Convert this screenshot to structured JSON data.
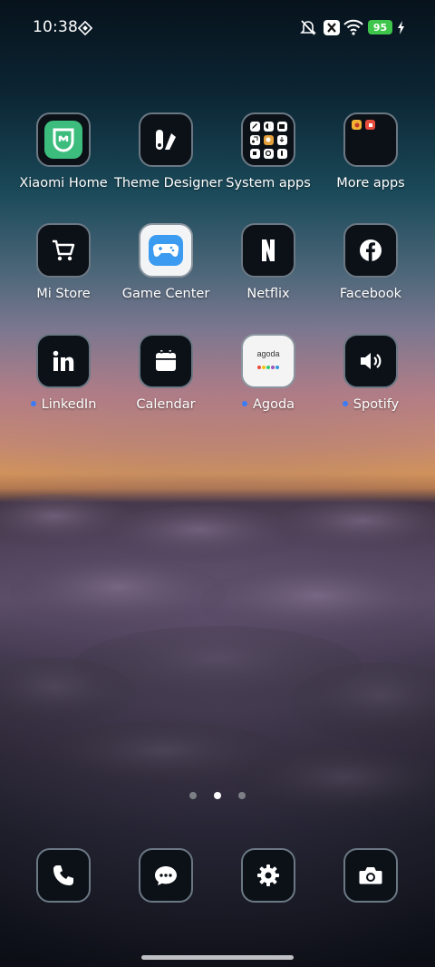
{
  "status_bar": {
    "time": "10:38",
    "battery_level": "95",
    "icons": [
      "screen-cast-icon",
      "mute-icon",
      "close-icon",
      "wifi-icon",
      "charging-icon"
    ]
  },
  "apps": [
    {
      "label": "Xiaomi Home",
      "icon": "xiaomi-home-icon",
      "badge": false
    },
    {
      "label": "Theme Designer",
      "icon": "theme-designer-icon",
      "badge": false
    },
    {
      "label": "System apps",
      "icon": "folder-icon",
      "badge": false
    },
    {
      "label": "More apps",
      "icon": "folder-icon",
      "badge": false
    },
    {
      "label": "Mi Store",
      "icon": "shopping-cart-icon",
      "badge": false
    },
    {
      "label": "Game Center",
      "icon": "game-controller-icon",
      "badge": false
    },
    {
      "label": "Netflix",
      "icon": "netflix-icon",
      "badge": false
    },
    {
      "label": "Facebook",
      "icon": "facebook-icon",
      "badge": false
    },
    {
      "label": "LinkedIn",
      "icon": "linkedin-icon",
      "badge": true
    },
    {
      "label": "Calendar",
      "icon": "calendar-icon",
      "badge": false
    },
    {
      "label": "Agoda",
      "icon": "agoda-icon",
      "badge": true
    },
    {
      "label": "Spotify",
      "icon": "speaker-icon",
      "badge": true
    }
  ],
  "agoda_logo_text": "agoda",
  "dock": [
    {
      "icon": "phone-icon"
    },
    {
      "icon": "messages-icon"
    },
    {
      "icon": "settings-icon"
    },
    {
      "icon": "camera-icon"
    }
  ],
  "pages": {
    "count": 3,
    "active": 2
  },
  "colors": {
    "tile_bg": "#0c1118",
    "tile_border": "#6b7884",
    "badge": "#3b7bf4",
    "battery": "#3ec64b",
    "xiaomi_green": "#3dbd7d",
    "game_blue": "#3a9bf0"
  }
}
